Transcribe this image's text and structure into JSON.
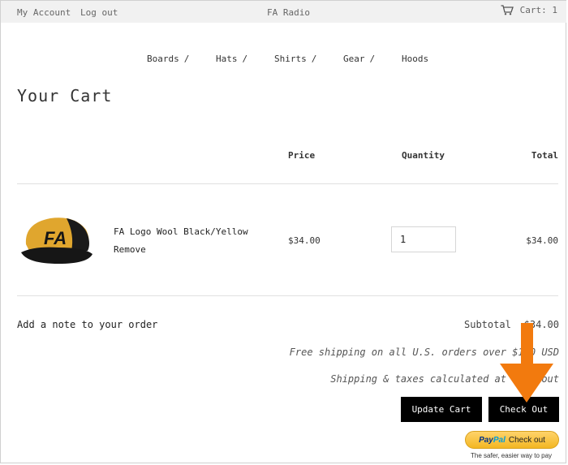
{
  "topbar": {
    "account_label": "My Account",
    "logout_label": "Log out",
    "site_title": "FA Radio",
    "cart_label": "Cart: 1"
  },
  "nav": {
    "items": [
      {
        "label": "Boards",
        "sep": "/"
      },
      {
        "label": "Hats",
        "sep": "/"
      },
      {
        "label": "Shirts",
        "sep": "/"
      },
      {
        "label": "Gear",
        "sep": "/"
      },
      {
        "label": "Hoods",
        "sep": ""
      }
    ]
  },
  "page": {
    "title": "Your Cart"
  },
  "table": {
    "headers": {
      "price": "Price",
      "quantity": "Quantity",
      "total": "Total"
    },
    "item": {
      "title": "FA Logo Wool Black/Yellow",
      "remove_label": "Remove",
      "price": "$34.00",
      "quantity": "1",
      "total": "$34.00",
      "image_icon": "cap-product-image"
    }
  },
  "summary": {
    "note_label": "Add a note to your order",
    "subtotal_label": "Subtotal",
    "subtotal_value": "$34.00",
    "shipping_note": "Free shipping on all U.S. orders over $100 USD",
    "taxes_note": "Shipping & taxes calculated at checkout"
  },
  "buttons": {
    "update_label": "Update Cart",
    "checkout_label": "Check Out"
  },
  "paypal": {
    "logo_pay": "Pay",
    "logo_pal": "Pal",
    "checkout_label": "Check out",
    "tagline": "The safer, easier way to pay"
  },
  "colors": {
    "topbar_bg": "#f1f1f1",
    "button_bg": "#000000",
    "arrow": "#f27a0e",
    "paypal_yellow": "#ffc439",
    "cap_yellow": "#e0a62e"
  }
}
